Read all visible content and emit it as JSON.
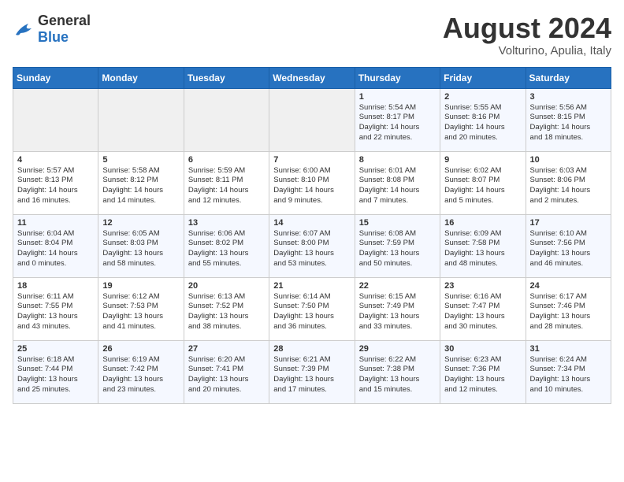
{
  "logo": {
    "general": "General",
    "blue": "Blue"
  },
  "title": "August 2024",
  "subtitle": "Volturino, Apulia, Italy",
  "days_of_week": [
    "Sunday",
    "Monday",
    "Tuesday",
    "Wednesday",
    "Thursday",
    "Friday",
    "Saturday"
  ],
  "weeks": [
    [
      {
        "day": "",
        "info": ""
      },
      {
        "day": "",
        "info": ""
      },
      {
        "day": "",
        "info": ""
      },
      {
        "day": "",
        "info": ""
      },
      {
        "day": "1",
        "info": "Sunrise: 5:54 AM\nSunset: 8:17 PM\nDaylight: 14 hours\nand 22 minutes."
      },
      {
        "day": "2",
        "info": "Sunrise: 5:55 AM\nSunset: 8:16 PM\nDaylight: 14 hours\nand 20 minutes."
      },
      {
        "day": "3",
        "info": "Sunrise: 5:56 AM\nSunset: 8:15 PM\nDaylight: 14 hours\nand 18 minutes."
      }
    ],
    [
      {
        "day": "4",
        "info": "Sunrise: 5:57 AM\nSunset: 8:13 PM\nDaylight: 14 hours\nand 16 minutes."
      },
      {
        "day": "5",
        "info": "Sunrise: 5:58 AM\nSunset: 8:12 PM\nDaylight: 14 hours\nand 14 minutes."
      },
      {
        "day": "6",
        "info": "Sunrise: 5:59 AM\nSunset: 8:11 PM\nDaylight: 14 hours\nand 12 minutes."
      },
      {
        "day": "7",
        "info": "Sunrise: 6:00 AM\nSunset: 8:10 PM\nDaylight: 14 hours\nand 9 minutes."
      },
      {
        "day": "8",
        "info": "Sunrise: 6:01 AM\nSunset: 8:08 PM\nDaylight: 14 hours\nand 7 minutes."
      },
      {
        "day": "9",
        "info": "Sunrise: 6:02 AM\nSunset: 8:07 PM\nDaylight: 14 hours\nand 5 minutes."
      },
      {
        "day": "10",
        "info": "Sunrise: 6:03 AM\nSunset: 8:06 PM\nDaylight: 14 hours\nand 2 minutes."
      }
    ],
    [
      {
        "day": "11",
        "info": "Sunrise: 6:04 AM\nSunset: 8:04 PM\nDaylight: 14 hours\nand 0 minutes."
      },
      {
        "day": "12",
        "info": "Sunrise: 6:05 AM\nSunset: 8:03 PM\nDaylight: 13 hours\nand 58 minutes."
      },
      {
        "day": "13",
        "info": "Sunrise: 6:06 AM\nSunset: 8:02 PM\nDaylight: 13 hours\nand 55 minutes."
      },
      {
        "day": "14",
        "info": "Sunrise: 6:07 AM\nSunset: 8:00 PM\nDaylight: 13 hours\nand 53 minutes."
      },
      {
        "day": "15",
        "info": "Sunrise: 6:08 AM\nSunset: 7:59 PM\nDaylight: 13 hours\nand 50 minutes."
      },
      {
        "day": "16",
        "info": "Sunrise: 6:09 AM\nSunset: 7:58 PM\nDaylight: 13 hours\nand 48 minutes."
      },
      {
        "day": "17",
        "info": "Sunrise: 6:10 AM\nSunset: 7:56 PM\nDaylight: 13 hours\nand 46 minutes."
      }
    ],
    [
      {
        "day": "18",
        "info": "Sunrise: 6:11 AM\nSunset: 7:55 PM\nDaylight: 13 hours\nand 43 minutes."
      },
      {
        "day": "19",
        "info": "Sunrise: 6:12 AM\nSunset: 7:53 PM\nDaylight: 13 hours\nand 41 minutes."
      },
      {
        "day": "20",
        "info": "Sunrise: 6:13 AM\nSunset: 7:52 PM\nDaylight: 13 hours\nand 38 minutes."
      },
      {
        "day": "21",
        "info": "Sunrise: 6:14 AM\nSunset: 7:50 PM\nDaylight: 13 hours\nand 36 minutes."
      },
      {
        "day": "22",
        "info": "Sunrise: 6:15 AM\nSunset: 7:49 PM\nDaylight: 13 hours\nand 33 minutes."
      },
      {
        "day": "23",
        "info": "Sunrise: 6:16 AM\nSunset: 7:47 PM\nDaylight: 13 hours\nand 30 minutes."
      },
      {
        "day": "24",
        "info": "Sunrise: 6:17 AM\nSunset: 7:46 PM\nDaylight: 13 hours\nand 28 minutes."
      }
    ],
    [
      {
        "day": "25",
        "info": "Sunrise: 6:18 AM\nSunset: 7:44 PM\nDaylight: 13 hours\nand 25 minutes."
      },
      {
        "day": "26",
        "info": "Sunrise: 6:19 AM\nSunset: 7:42 PM\nDaylight: 13 hours\nand 23 minutes."
      },
      {
        "day": "27",
        "info": "Sunrise: 6:20 AM\nSunset: 7:41 PM\nDaylight: 13 hours\nand 20 minutes."
      },
      {
        "day": "28",
        "info": "Sunrise: 6:21 AM\nSunset: 7:39 PM\nDaylight: 13 hours\nand 17 minutes."
      },
      {
        "day": "29",
        "info": "Sunrise: 6:22 AM\nSunset: 7:38 PM\nDaylight: 13 hours\nand 15 minutes."
      },
      {
        "day": "30",
        "info": "Sunrise: 6:23 AM\nSunset: 7:36 PM\nDaylight: 13 hours\nand 12 minutes."
      },
      {
        "day": "31",
        "info": "Sunrise: 6:24 AM\nSunset: 7:34 PM\nDaylight: 13 hours\nand 10 minutes."
      }
    ]
  ]
}
